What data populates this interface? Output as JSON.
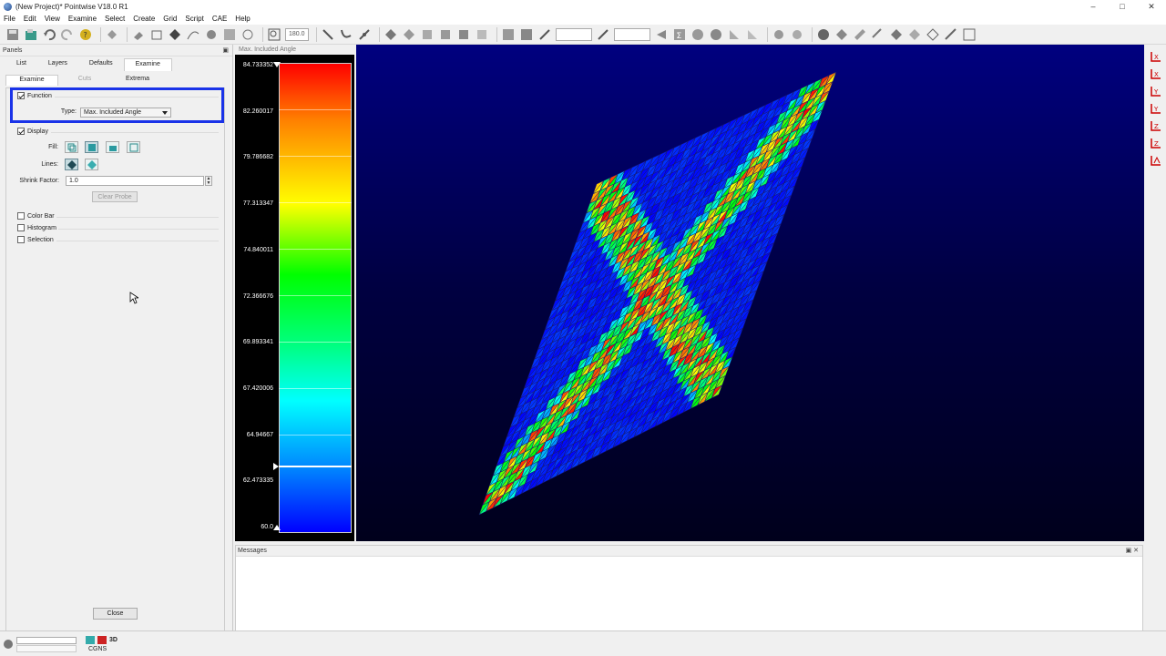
{
  "window": {
    "title": "(New Project)* Pointwise V18.0 R1",
    "controls": [
      "–",
      "□",
      "✕"
    ]
  },
  "menu": [
    "File",
    "Edit",
    "View",
    "Examine",
    "Select",
    "Create",
    "Grid",
    "Script",
    "CAE",
    "Help"
  ],
  "toolbar": {
    "view_angle": "180.0",
    "field2": "",
    "field3": ""
  },
  "panels": {
    "header": "Panels",
    "restore_icon": "▣",
    "tabs": [
      "List",
      "Layers",
      "Defaults",
      "Examine"
    ],
    "active_tab": "Examine",
    "subtabs": [
      "Examine",
      "Cuts",
      "Extrema"
    ],
    "function": {
      "label": "Function",
      "checked": true,
      "type_label": "Type:",
      "type_value": "Max. Included Angle"
    },
    "display": {
      "label": "Display",
      "checked": true,
      "fill_label": "Fill:",
      "lines_label": "Lines:",
      "shrink_label": "Shrink Factor:",
      "shrink_value": "1.0",
      "clear_probe": "Clear Probe"
    },
    "options": [
      {
        "label": "Color Bar",
        "checked": false
      },
      {
        "label": "Histogram",
        "checked": false
      },
      {
        "label": "Selection",
        "checked": false
      }
    ],
    "close_label": "Close"
  },
  "colorbar": {
    "title": "Max. Included Angle",
    "ticks": [
      "84.733352",
      "82.260017",
      "79.786682",
      "77.313347",
      "74.840011",
      "72.366676",
      "69.893341",
      "67.420006",
      "64.94667",
      "62.473335",
      "60.0"
    ],
    "max": 84.733352,
    "min": 60.0
  },
  "messages": {
    "header": "Messages",
    "controls": "▣ ✕"
  },
  "status": {
    "mode": "3D",
    "solver": "CGNS"
  },
  "colors": {
    "highlight": "#1a33e8",
    "viewport_top": "#00007f",
    "mesh_low": "#0000ff",
    "mesh_high": "#ff0000"
  }
}
